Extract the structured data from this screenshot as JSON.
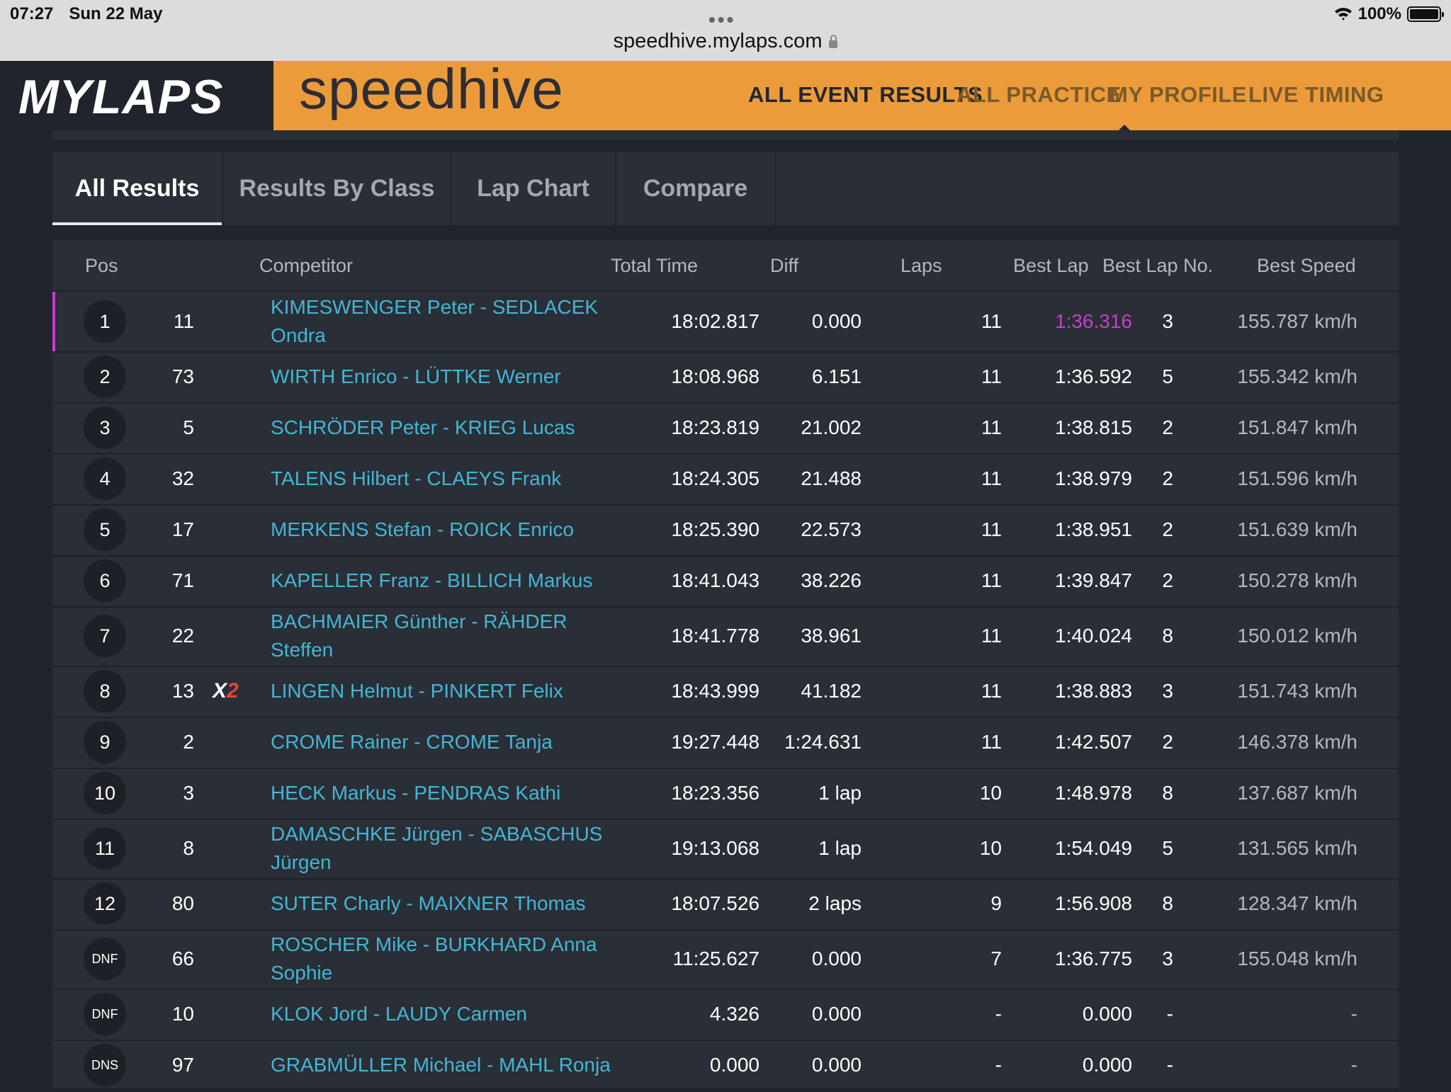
{
  "status": {
    "time": "07:27",
    "date": "Sun 22 May",
    "url": "speedhive.mylaps.com",
    "battery": "100%"
  },
  "nav": {
    "logo": "MYLAPS",
    "brand": "speedhive",
    "items": [
      "ALL EVENT RESULTS",
      "ALL PRACTICE",
      "MY PROFILE",
      "LIVE TIMING"
    ],
    "accent": "#ec9b3b"
  },
  "tabs": [
    "All Results",
    "Results By Class",
    "Lap Chart",
    "Compare"
  ],
  "table": {
    "headers": {
      "pos": "Pos",
      "competitor": "Competitor",
      "total": "Total Time",
      "diff": "Diff",
      "laps": "Laps",
      "bestlap": "Best Lap",
      "bestlapno": "Best Lap No.",
      "speed": "Best Speed"
    },
    "rows": [
      {
        "pos": "1",
        "no": "11",
        "name": "KIMESWENGER Peter - SEDLACEK Ondra",
        "total": "18:02.817",
        "diff": "0.000",
        "laps": "11",
        "bestlap": "1:36.316",
        "bestlapno": "3",
        "speed": "155.787 km/h"
      },
      {
        "pos": "2",
        "no": "73",
        "name": "WIRTH Enrico - LÜTTKE Werner",
        "total": "18:08.968",
        "diff": "6.151",
        "laps": "11",
        "bestlap": "1:36.592",
        "bestlapno": "5",
        "speed": "155.342 km/h"
      },
      {
        "pos": "3",
        "no": "5",
        "name": "SCHRÖDER Peter - KRIEG Lucas",
        "total": "18:23.819",
        "diff": "21.002",
        "laps": "11",
        "bestlap": "1:38.815",
        "bestlapno": "2",
        "speed": "151.847 km/h"
      },
      {
        "pos": "4",
        "no": "32",
        "name": "TALENS Hilbert - CLAEYS Frank",
        "total": "18:24.305",
        "diff": "21.488",
        "laps": "11",
        "bestlap": "1:38.979",
        "bestlapno": "2",
        "speed": "151.596 km/h"
      },
      {
        "pos": "5",
        "no": "17",
        "name": "MERKENS Stefan - ROICK Enrico",
        "total": "18:25.390",
        "diff": "22.573",
        "laps": "11",
        "bestlap": "1:38.951",
        "bestlapno": "2",
        "speed": "151.639 km/h"
      },
      {
        "pos": "6",
        "no": "71",
        "name": "KAPELLER Franz - BILLICH Markus",
        "total": "18:41.043",
        "diff": "38.226",
        "laps": "11",
        "bestlap": "1:39.847",
        "bestlapno": "2",
        "speed": "150.278 km/h"
      },
      {
        "pos": "7",
        "no": "22",
        "name": "BACHMAIER Günther - RÄHDER Steffen",
        "total": "18:41.778",
        "diff": "38.961",
        "laps": "11",
        "bestlap": "1:40.024",
        "bestlapno": "8",
        "speed": "150.012 km/h"
      },
      {
        "pos": "8",
        "no": "13",
        "badge_x": "X",
        "badge_n": "2",
        "name": "LINGEN Helmut - PINKERT Felix",
        "total": "18:43.999",
        "diff": "41.182",
        "laps": "11",
        "bestlap": "1:38.883",
        "bestlapno": "3",
        "speed": "151.743 km/h"
      },
      {
        "pos": "9",
        "no": "2",
        "name": "CROME Rainer - CROME Tanja",
        "total": "19:27.448",
        "diff": "1:24.631",
        "laps": "11",
        "bestlap": "1:42.507",
        "bestlapno": "2",
        "speed": "146.378 km/h"
      },
      {
        "pos": "10",
        "no": "3",
        "name": "HECK Markus - PENDRAS Kathi",
        "total": "18:23.356",
        "diff": "1 lap",
        "laps": "10",
        "bestlap": "1:48.978",
        "bestlapno": "8",
        "speed": "137.687 km/h"
      },
      {
        "pos": "11",
        "no": "8",
        "name": "DAMASCHKE Jürgen - SABASCHUS Jürgen",
        "total": "19:13.068",
        "diff": "1 lap",
        "laps": "10",
        "bestlap": "1:54.049",
        "bestlapno": "5",
        "speed": "131.565 km/h"
      },
      {
        "pos": "12",
        "no": "80",
        "name": "SUTER Charly - MAIXNER Thomas",
        "total": "18:07.526",
        "diff": "2 laps",
        "laps": "9",
        "bestlap": "1:56.908",
        "bestlapno": "8",
        "speed": "128.347 km/h"
      },
      {
        "pos": "DNF",
        "no": "66",
        "name": "ROSCHER Mike - BURKHARD Anna Sophie",
        "total": "11:25.627",
        "diff": "0.000",
        "laps": "7",
        "bestlap": "1:36.775",
        "bestlapno": "3",
        "speed": "155.048 km/h"
      },
      {
        "pos": "DNF",
        "no": "10",
        "name": "KLOK Jord - LAUDY Carmen",
        "total": "4.326",
        "diff": "0.000",
        "laps": "-",
        "bestlap": "0.000",
        "bestlapno": "-",
        "speed": "-"
      },
      {
        "pos": "DNS",
        "no": "97",
        "name": "GRABMÜLLER Michael - MAHL Ronja",
        "total": "0.000",
        "diff": "0.000",
        "laps": "-",
        "bestlap": "0.000",
        "bestlapno": "-",
        "speed": "-"
      }
    ]
  }
}
